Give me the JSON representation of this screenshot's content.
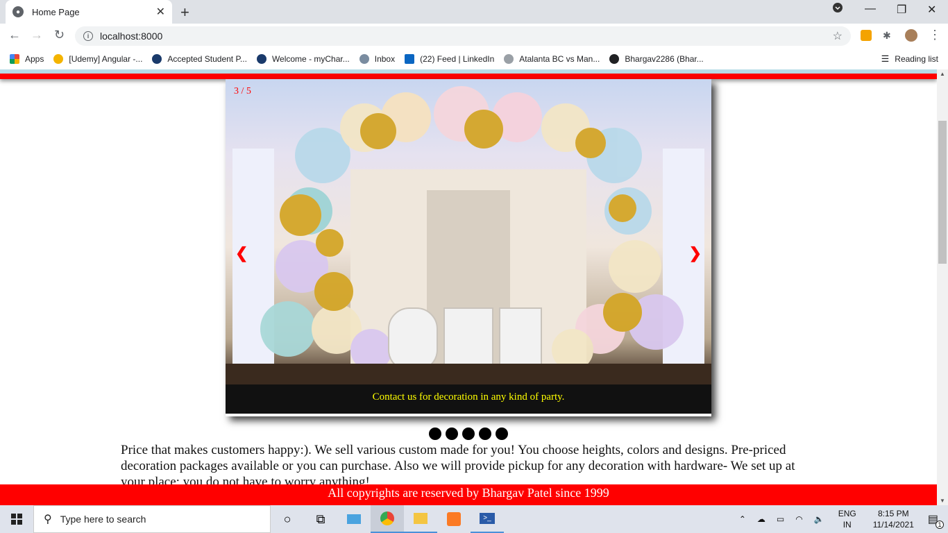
{
  "browser": {
    "tab_title": "Home Page",
    "tab_close": "✕",
    "new_tab": "+",
    "url": "localhost:8000",
    "bookmarks": [
      {
        "label": "Apps",
        "color": "#e8453c"
      },
      {
        "label": "[Udemy] Angular -...",
        "color": "#f4b400"
      },
      {
        "label": "Accepted Student P...",
        "color": "#1a3a6b"
      },
      {
        "label": "Welcome - myChar...",
        "color": "#1a3a6b"
      },
      {
        "label": "Inbox",
        "color": "#7a8ca0"
      },
      {
        "label": "(22) Feed | LinkedIn",
        "color": "#0a66c2"
      },
      {
        "label": "Atalanta BC vs Man...",
        "color": "#9aa0a6"
      },
      {
        "label": "Bhargav2286 (Bhar...",
        "color": "#202124"
      }
    ],
    "reading_list": "Reading list"
  },
  "slideshow": {
    "counter": "3 / 5",
    "prev": "❮",
    "next": "❯",
    "caption": "Contact us for decoration in any kind of party.",
    "dots_count": 5
  },
  "main": {
    "description": "Price that makes customers happy:). We sell various custom made for you! You choose heights, colors and designs. Pre-priced decoration packages available or you can purchase. Also we will provide pickup for any decoration with hardware- We set up at your place; you do not have to worry anything!"
  },
  "footer": {
    "text": "All copyrights are reserved by Bhargav Patel since 1999"
  },
  "taskbar": {
    "search_placeholder": "Type here to search",
    "language_top": "ENG",
    "language_bottom": "IN",
    "time": "8:15 PM",
    "date": "11/14/2021",
    "notification_count": "1"
  }
}
